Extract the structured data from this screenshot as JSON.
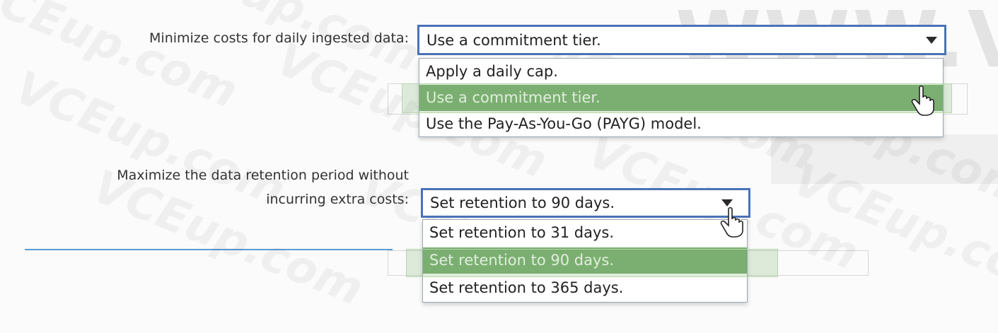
{
  "watermark": {
    "main": "WWW.VC",
    "repeat": [
      "CEup.com",
      "VCEup.com",
      "VCEup.com",
      "VCEup.com",
      "VCEup.co",
      "VCEup.com",
      "VCEup.com",
      "VCEup.com",
      "VCEup.com",
      "VCEup.com"
    ]
  },
  "question1": {
    "label": "Minimize costs for daily ingested data:",
    "selected_value": "Use a commitment tier.",
    "options": [
      "Apply a daily cap.",
      "Use a commitment tier.",
      "Use the Pay-As-You-Go (PAYG) model."
    ],
    "highlighted_option": "Use a commitment tier."
  },
  "question2": {
    "label_line1": "Maximize the data retention period without",
    "label_line2": "incurring extra costs:",
    "selected_value": "Set retention to 90 days.",
    "options": [
      "Set retention to 31 days.",
      "Set retention to 90 days.",
      "Set retention to 365 days."
    ],
    "highlighted_option": "Set retention to 90 days."
  },
  "colors": {
    "select_border": "#4a72b8",
    "highlight": "#79ad6f",
    "rule": "#5b9bd5"
  },
  "icons": {
    "cursor": "hand-pointer-icon",
    "dropdown": "triangle-down-icon"
  }
}
